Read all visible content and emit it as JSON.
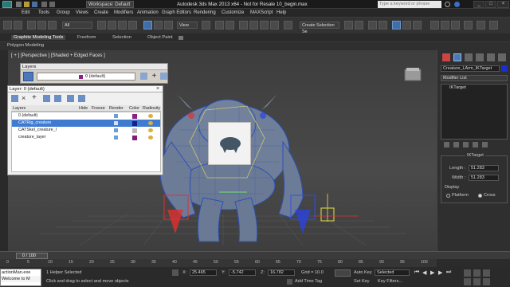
{
  "titlebar": {
    "workspace": "Workspace: Default",
    "title": "Autodesk 3ds Max  2013 x64  - Not for Resale   10_begin.max",
    "search_placeholder": "Type a keyword or phrase"
  },
  "menu": [
    "Edit",
    "Tools",
    "Group",
    "Views",
    "Create",
    "Modifiers",
    "Animation",
    "Graph Editors",
    "Rendering",
    "Customize",
    "MAXScript",
    "Help"
  ],
  "toolbar": {
    "filter": "All",
    "view": "View",
    "selection_set": "Create Selection Se"
  },
  "ribbon": {
    "tabs": [
      "Graphite Modeling Tools",
      "Freeform",
      "Selection",
      "Object Paint"
    ],
    "subtitle": "Polygon Modeling"
  },
  "viewport": {
    "label": "[ + ] [Perspective ] [Shaded + Edged Faces ]"
  },
  "layers_toolbar": {
    "title": "Layers",
    "layer": "0 (default)"
  },
  "layer_dialog": {
    "title": "Layer: 0 (default)",
    "columns": [
      "Layers",
      "Hide",
      "Freeze",
      "Render",
      "Color",
      "Radiosity"
    ],
    "rows": [
      {
        "name": "0 (default)",
        "color": "#8c1f86"
      },
      {
        "name": "CATRig_creature",
        "color": "#1a1f8a"
      },
      {
        "name": "CATSkel_creature_l",
        "color": "#b8b8b8"
      },
      {
        "name": "creature_layer",
        "color": "#861a7c"
      }
    ]
  },
  "command_panel": {
    "object_name": "Creature_LArm_IKTarget",
    "modifier_list": "Modifier List",
    "stack_item": "IKTarget",
    "rollout": "IKTarget",
    "length_label": "Length :",
    "length_value": "51.283",
    "width_label": "Width :",
    "width_value": "51.283",
    "display_label": "Display",
    "platform": "Platform",
    "cross": "Cross"
  },
  "timeline": {
    "frame": "0 / 100",
    "ticks": [
      "0",
      "5",
      "10",
      "15",
      "20",
      "25",
      "30",
      "35",
      "40",
      "45",
      "50",
      "55",
      "60",
      "65",
      "70",
      "75",
      "80",
      "85",
      "90",
      "95",
      "100"
    ]
  },
  "status": {
    "script_line1": "actionMan.exe",
    "script_line2": "Welcome to M",
    "selected": "1 Helper Selected",
    "prompt": "Click and drag to select and move objects",
    "x_label": "X:",
    "x": "25.465",
    "y_label": "Y:",
    "y": "-5.742",
    "z_label": "Z:",
    "z": "16.782",
    "grid": "Grid = 10.0",
    "auto_key": "Auto Key",
    "set_key": "Set Key",
    "key_mode": "Selected",
    "key_filters": "Key Filters...",
    "add_time_tag": "Add Time Tag"
  }
}
